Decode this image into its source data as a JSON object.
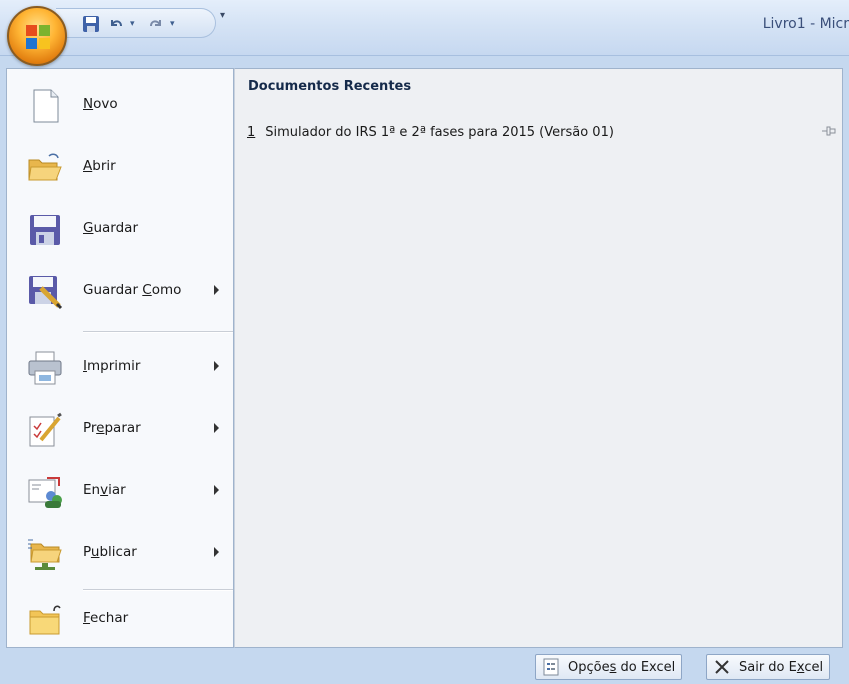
{
  "window": {
    "title": "Livro1 - Micr"
  },
  "qat": {
    "save": "save-icon",
    "undo": "undo-icon",
    "redo": "redo-icon",
    "customize": "▾"
  },
  "menu": {
    "items": [
      {
        "pre": "",
        "key": "N",
        "post": "ovo",
        "icon": "new-document-icon",
        "submenu": false
      },
      {
        "pre": "",
        "key": "A",
        "post": "brir",
        "icon": "open-folder-icon",
        "submenu": false
      },
      {
        "pre": "",
        "key": "G",
        "post": "uardar",
        "icon": "floppy-disk-icon",
        "submenu": false
      },
      {
        "pre": "Guardar ",
        "key": "C",
        "post": "omo",
        "icon": "save-as-icon",
        "submenu": true
      },
      {
        "pre": "",
        "key": "I",
        "post": "mprimir",
        "icon": "printer-icon",
        "submenu": true
      },
      {
        "pre": "Pr",
        "key": "e",
        "post": "parar",
        "icon": "prepare-icon",
        "submenu": true
      },
      {
        "pre": "En",
        "key": "v",
        "post": "iar",
        "icon": "send-icon",
        "submenu": true
      },
      {
        "pre": "P",
        "key": "u",
        "post": "blicar",
        "icon": "publish-icon",
        "submenu": true
      },
      {
        "pre": "",
        "key": "F",
        "post": "echar",
        "icon": "close-folder-icon",
        "submenu": false
      }
    ]
  },
  "recent": {
    "title": "Documentos Recentes",
    "items": [
      {
        "num": "1",
        "name": "Simulador do IRS 1ª e 2ª fases para 2015  (Versão 01)"
      }
    ]
  },
  "footer": {
    "options": {
      "pre": "Opçõe",
      "key": "s",
      "post": " do Excel"
    },
    "exit": {
      "pre": "Sair do E",
      "key": "x",
      "post": "cel"
    }
  },
  "colors": {
    "accent": "#f29a1c",
    "frame": "#c5d8ef",
    "panel": "#eef0f3"
  }
}
